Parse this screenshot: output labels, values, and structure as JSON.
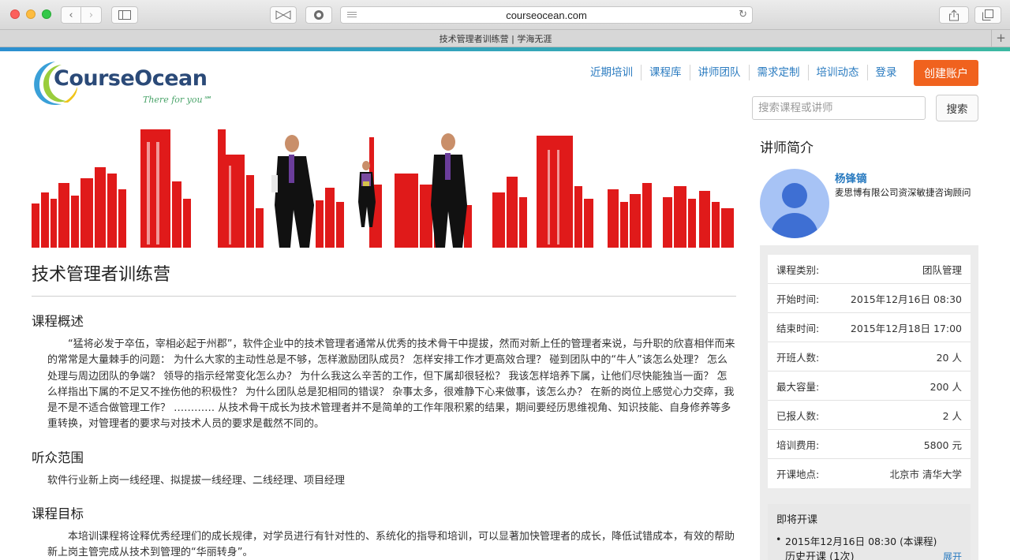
{
  "browser": {
    "url": "courseocean.com",
    "tab_title": "技术管理者训练营 | 学海无涯"
  },
  "logo": {
    "brand": "CourseOcean",
    "tagline": "There for you℠"
  },
  "nav": {
    "items": [
      "近期培训",
      "课程库",
      "讲师团队",
      "需求定制",
      "培训动态",
      "登录"
    ],
    "create_account": "创建账户"
  },
  "search": {
    "placeholder": "搜索课程或讲师",
    "button": "搜索"
  },
  "course": {
    "title": "技术管理者训练营",
    "sections": [
      {
        "heading": "课程概述",
        "text": "“猛将必发于卒伍，宰相必起于州郡”，软件企业中的技术管理者通常从优秀的技术骨干中提拔，然而对新上任的管理者来说，与升职的欣喜相伴而来的常常是大量棘手的问题： 为什么大家的主动性总是不够，怎样激励团队成员？ 怎样安排工作才更高效合理？ 碰到团队中的“牛人”该怎么处理？ 怎么处理与周边团队的争端？ 领导的指示经常变化怎么办？ 为什么我这么辛苦的工作，但下属却很轻松？ 我该怎样培养下属，让他们尽快能独当一面？ 怎么样指出下属的不足又不挫伤他的积极性？ 为什么团队总是犯相同的错误？ 杂事太多，很难静下心来做事，该怎么办？ 在新的岗位上感觉心力交瘁，我是不是不适合做管理工作？ ………… 从技术骨干成长为技术管理者并不是简单的工作年限积累的结果，期间要经历思维视角、知识技能、自身修养等多重转换，对管理者的要求与对技术人员的要求是截然不同的。"
      },
      {
        "heading": "听众范围",
        "text": "软件行业新上岗一线经理、拟提拔一线经理、二线经理、项目经理"
      },
      {
        "heading": "课程目标",
        "text": "本培训课程将诠释优秀经理们的成长规律，对学员进行有针对性的、系统化的指导和培训，可以显著加快管理者的成长，降低试错成本，有效的帮助新上岗主管完成从技术到管理的“华丽转身”。"
      }
    ]
  },
  "sidebar": {
    "title": "讲师简介",
    "lecturer_name": "杨锋镝",
    "lecturer_title": "麦思博有限公司资深敏捷咨询顾问",
    "info": [
      {
        "label": "课程类别:",
        "value": "团队管理"
      },
      {
        "label": "开始时间:",
        "value": "2015年12月16日 08:30"
      },
      {
        "label": "结束时间:",
        "value": "2015年12月18日 17:00"
      },
      {
        "label": "开班人数:",
        "value": "20 人"
      },
      {
        "label": "最大容量:",
        "value": "200 人"
      },
      {
        "label": "已报人数:",
        "value": "2 人"
      },
      {
        "label": "培训费用:",
        "value": "5800 元"
      },
      {
        "label": "开课地点:",
        "value": "北京市 清华大学"
      }
    ],
    "upcoming_heading": "即将开课",
    "upcoming_item": "2015年12月16日 08:30 (本课程)",
    "history": "历史开课 (1次)",
    "expand": "展开"
  }
}
